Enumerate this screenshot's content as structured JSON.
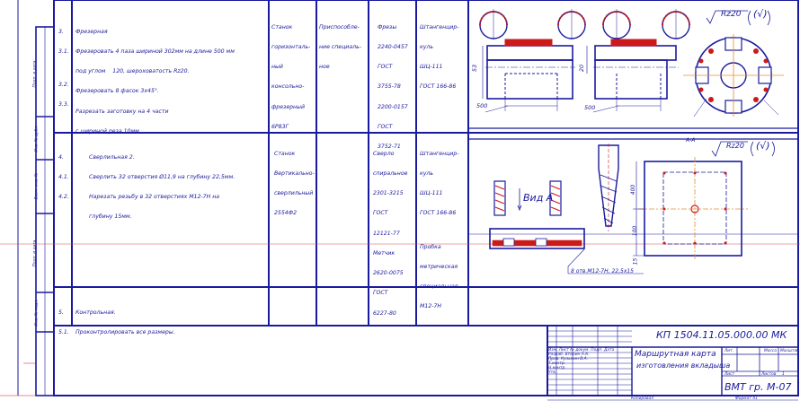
{
  "colors": {
    "line": "#1a1a9e",
    "hatch": "#cc1a1a",
    "marker": "#d94a4a",
    "paper": "#ffffff"
  },
  "rows": [
    {
      "num": [
        "3.",
        "3.1.",
        "",
        "3.2.",
        "3.3."
      ],
      "content": [
        "Фрезерная",
        "Фрезеровать 4 паза шириной 302мм на длине 500 мм",
        "под углом    120, шероховатость Rz20.",
        "Фрезеровать 8 фасок 3x45°.",
        "Разрезать заготовку на 4 части",
        "с шириной реза 10мм."
      ],
      "machine": [
        "Станок",
        "горизонталь-",
        "ный",
        "консольно-",
        "фрезерный",
        "6Р83Г"
      ],
      "fixture": [
        "Приспособле-",
        "ние специаль-",
        "ное"
      ],
      "tool": [
        "Фрезы",
        "2240-0457",
        "ГОСТ",
        "3755-78",
        "2200-0157",
        "ГОСТ",
        "3752-71"
      ],
      "measure": [
        "Штангенцир-",
        "куль",
        "ШЦ-111",
        "ГОСТ 166-86"
      ]
    },
    {
      "num": [
        "4.",
        "4.1.",
        "4.2."
      ],
      "content": [
        "Сверлильная 2.",
        "Сверлить 32 отверстия Ø11,9 на глубину 22,5мм.",
        "Нарезать резьбу в 32 отверстиях М12-7Н на",
        "глубину 15мм."
      ],
      "machine": [
        "Станок",
        "Вертикально-",
        "сверлильный",
        "2554Ф2"
      ],
      "fixture": [],
      "tool": [
        "Сверло",
        "спиральное",
        "2301-3215",
        "ГОСТ",
        "12121-77",
        "Метчик",
        "2620-0075",
        "ГОСТ",
        "6227-80"
      ],
      "measure": [
        "Штангенцир-",
        "куль",
        "ШЦ-111",
        "ГОСТ 166-86",
        "",
        "Пробка",
        "метрическая",
        "специальная",
        "М12-7Н"
      ]
    },
    {
      "num": [
        "5.",
        "5.1."
      ],
      "content": [
        "Контрольная.",
        "Проконтролировать все размеры."
      ],
      "machine": [],
      "fixture": [],
      "tool": [],
      "measure": []
    }
  ],
  "drawing": {
    "roughness": "Rz20",
    "roughness_check": "(√)",
    "dim_500a": "500",
    "dim_500b": "500",
    "dim_53": "53",
    "dim_20": "20",
    "view_label": "Вид А",
    "section_label": "А-А",
    "dim_400": "400",
    "dim_100": "100",
    "dim_15": "15",
    "holes_note": "8 отв.М12-7Н, 22,5x15"
  },
  "titleblock": {
    "code": "КП 1504.11.05.000.00 МК",
    "title_line1": "Маршрутная карта",
    "title_line2": "изготовления вкладыша",
    "group": "ВМТ гр. М-07",
    "lit_header": "Лит.",
    "mass_header": "Масса",
    "scale_header": "Масштаб",
    "sheet_label": "Лист",
    "sheets_label": "Листов",
    "sheets_value": "1",
    "copied": "Копировал",
    "format": "Формат  А1",
    "rows": [
      "Изм. Лист  № докум.  Подп.  Дата",
      "Разраб.  Вторин А.К.",
      "Пров.  Кузьмин В.А.",
      "Т.контр.",
      "",
      "Н.контр.",
      "Утв."
    ]
  },
  "sidebar": {
    "labels": [
      "Подп. и дата",
      "Инв. № дубл.",
      "Взам. инв. №",
      "Подп. и дата",
      "Инв. № подл."
    ]
  }
}
